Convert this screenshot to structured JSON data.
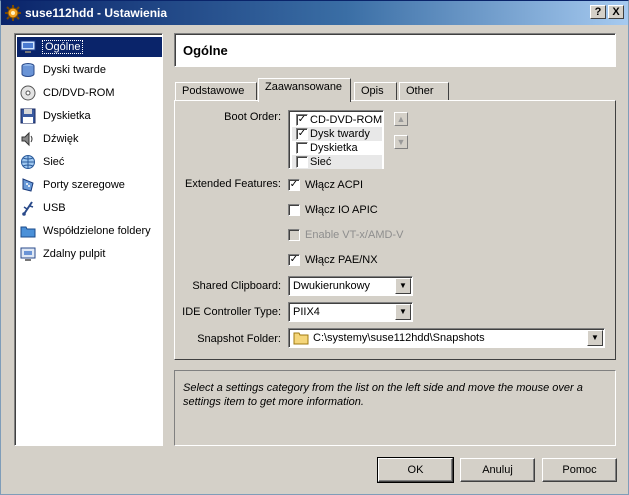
{
  "window": {
    "title": "suse112hdd - Ustawienia",
    "help_button": "?",
    "close_button": "X"
  },
  "sidebar": {
    "items": [
      {
        "label": "Ogólne",
        "icon": "general-monitor-icon",
        "selected": true
      },
      {
        "label": "Dyski twarde",
        "icon": "hard-disk-icon"
      },
      {
        "label": "CD/DVD-ROM",
        "icon": "cd-dvd-icon"
      },
      {
        "label": "Dyskietka",
        "icon": "floppy-icon"
      },
      {
        "label": "Dźwięk",
        "icon": "audio-speaker-icon"
      },
      {
        "label": "Sieć",
        "icon": "network-icon"
      },
      {
        "label": "Porty szeregowe",
        "icon": "serial-port-icon"
      },
      {
        "label": "USB",
        "icon": "usb-icon"
      },
      {
        "label": "Współdzielone foldery",
        "icon": "shared-folder-icon"
      },
      {
        "label": "Zdalny pulpit",
        "icon": "remote-display-icon"
      }
    ]
  },
  "header": {
    "title": "Ogólne"
  },
  "tabs": [
    {
      "label": "Podstawowe",
      "active": false
    },
    {
      "label": "Zaawansowane",
      "active": true
    },
    {
      "label": "Opis",
      "active": false
    },
    {
      "label": "Other",
      "active": false
    }
  ],
  "advanced": {
    "boot_order_label": "Boot Order:",
    "boot_order": [
      {
        "label": "CD-DVD-ROM",
        "checked": true
      },
      {
        "label": "Dysk twardy",
        "checked": true
      },
      {
        "label": "Dyskietka",
        "checked": false
      },
      {
        "label": "Sieć",
        "checked": false
      }
    ],
    "extended_features_label": "Extended Features:",
    "features": [
      {
        "label": "Włącz ACPI",
        "checked": true,
        "enabled": true
      },
      {
        "label": "Włącz IO APIC",
        "checked": false,
        "enabled": true
      },
      {
        "label": "Enable VT-x/AMD-V",
        "checked": false,
        "enabled": false
      },
      {
        "label": "Włącz PAE/NX",
        "checked": true,
        "enabled": true
      }
    ],
    "shared_clipboard_label": "Shared Clipboard:",
    "shared_clipboard_value": "Dwukierunkowy",
    "ide_controller_label": "IDE Controller Type:",
    "ide_controller_value": "PIIX4",
    "snapshot_folder_label": "Snapshot Folder:",
    "snapshot_folder_value": "C:\\systemy\\suse112hdd\\Snapshots"
  },
  "info_text": "Select a settings category from the list on the left side and move the mouse over a settings item to get more information.",
  "buttons": {
    "ok": "OK",
    "cancel": "Anuluj",
    "help": "Pomoc"
  },
  "colors": {
    "title_gradient_start": "#0a246a",
    "selection": "#0a246a",
    "face": "#d4d0c8"
  }
}
